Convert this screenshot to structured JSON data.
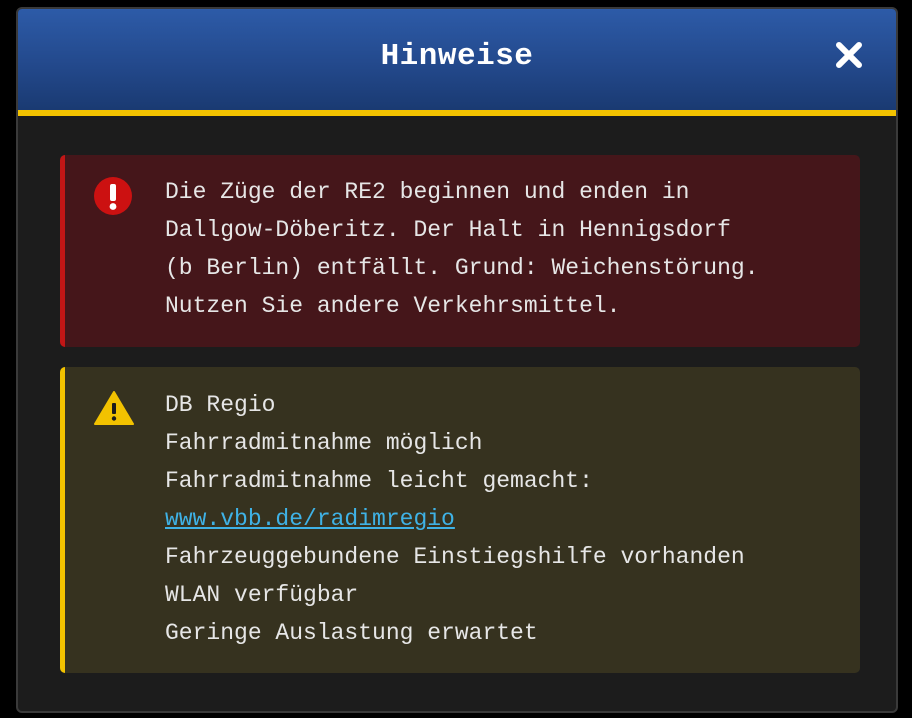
{
  "dialog": {
    "title": "Hinweise",
    "close_icon": "close-icon",
    "header_color": "#23498c",
    "accent_color": "#f2c200"
  },
  "messages": [
    {
      "severity": "error",
      "icon": "error-exclamation-icon",
      "color": "#c21616",
      "lines": [
        "Die Züge der RE2 beginnen und enden in",
        "Dallgow-Döberitz. Der Halt in Hennigsdorf",
        "(b Berlin) entfällt. Grund: Weichenstörung.",
        "Nutzen Sie andere Verkehrsmittel."
      ]
    },
    {
      "severity": "warning",
      "icon": "warning-triangle-icon",
      "color": "#f2c200",
      "lines": [
        "DB Regio",
        "Fahrradmitnahme möglich",
        "Fahrradmitnahme leicht gemacht:"
      ],
      "link": "www.vbb.de/radimregio",
      "lines_after": [
        "Fahrzeuggebundene Einstiegshilfe vorhanden",
        "WLAN verfügbar",
        "Geringe Auslastung erwartet"
      ]
    }
  ]
}
